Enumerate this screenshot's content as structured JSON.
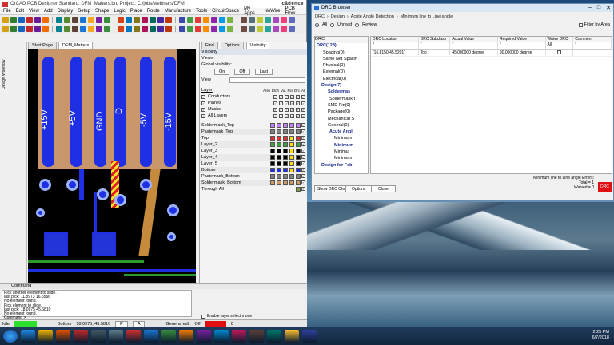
{
  "cad": {
    "title": "OrCAD PCB Designer Standard: DFM_Matters.brd  Project: C:/jobs/webinars/DFM",
    "brand": "cādence",
    "menu": [
      "File",
      "Edit",
      "View",
      "Add",
      "Display",
      "Setup",
      "Shape",
      "Logic",
      "Place",
      "Route",
      "Manufacture",
      "Tools",
      "CircuitSpace",
      "My Apps",
      "NoWire",
      "PCB Flow"
    ],
    "tabs": [
      "Start Page",
      "DFM_Matters"
    ],
    "side_label": "Design Workflow",
    "pins": [
      "+15V",
      "+5V",
      "GND",
      "D",
      "-5V",
      "-15V"
    ],
    "panel": {
      "tabs": [
        "Find",
        "Options",
        "Visibility"
      ],
      "header": "Visibility",
      "views": "Views",
      "global_visibility": "Global visibility:",
      "on": "On",
      "off": "Off",
      "last": "Last",
      "view_label": "View",
      "layer_header": "Layer",
      "cols": [
        "Areli",
        "Etch",
        "Via",
        "Pin",
        "Drc",
        "All"
      ],
      "checks": [
        "Conductors",
        "Planes",
        "Masks",
        "All Layers"
      ],
      "layers": [
        "Soldermask_Top",
        "Pastemask_Top",
        "Top",
        "Layer_2",
        "Layer_3",
        "Layer_4",
        "Layer_5",
        "Bottom",
        "Pastemask_Bottom",
        "Soldermask_Bottom",
        "Through All"
      ]
    },
    "command": {
      "header": "Command",
      "lines": [
        "Pick another element to slide.",
        "last pick:  11.8973 16.5566",
        "No element found.",
        "Pick element to slide.",
        "last pick:  18.0975 45.5810",
        "No element found.",
        "Command >"
      ]
    },
    "status": {
      "mode": "Idle",
      "layer": "Bottom",
      "coords": "18.0975, 45.5810",
      "p": "P",
      "a": "A",
      "edit": "General edit",
      "off": "Off",
      "zero": "0",
      "enable": "Enable layer select mode"
    }
  },
  "drc": {
    "title": "DRC Browser",
    "crumbs": [
      "DRC",
      "Design",
      "Acute Angle Detection",
      "Minimum line to Line angle"
    ],
    "radios": [
      "All",
      "Unread",
      "Review"
    ],
    "filter": "Filter by Area",
    "tree": [
      "DRC",
      "DRC(128)",
      "Spacing(0)",
      "Same Net Spacin",
      "Physical(0)",
      "External(0)",
      "Electrical(0)",
      "Design(7)",
      "Soldermas",
      "Soldermask t",
      "SMD Pin(0)",
      "Package(0)",
      "Mechanical S",
      "General(0)",
      "Acute Angl",
      "Minimum",
      "Minimum",
      "Minimu",
      "Minimum",
      "Design for Fab"
    ],
    "columns": [
      "DRC Location",
      "DRC Subclass",
      "Actual Value",
      "Required Value",
      "Waive DRC",
      "Comment"
    ],
    "filter_row": [
      "*",
      "*",
      "*",
      "*",
      "All",
      "*"
    ],
    "rows": [
      [
        "(16.8150 45.5201)",
        "Top",
        "45.000000 degree",
        "90.000000 degree",
        "",
        ""
      ]
    ],
    "buttons": [
      "Show DRC Chart",
      "Options",
      "Close"
    ],
    "errors_title": "Minimum line to Line angle Errors:",
    "total": "Total = 1",
    "waived": "Waived = 0",
    "badge": "DRC"
  },
  "clock": {
    "time": "2:25 PM",
    "date": "6/7/2018"
  },
  "taskbar_icons": [
    "start-icon",
    "ie-icon",
    "folder-icon",
    "media-icon",
    "cadence-icon",
    "app-icon",
    "app-icon",
    "app-icon",
    "app-icon",
    "app-icon",
    "app-icon",
    "app-icon",
    "app-icon",
    "app-icon",
    "app-icon",
    "app-icon",
    "app-icon",
    "app-icon"
  ]
}
